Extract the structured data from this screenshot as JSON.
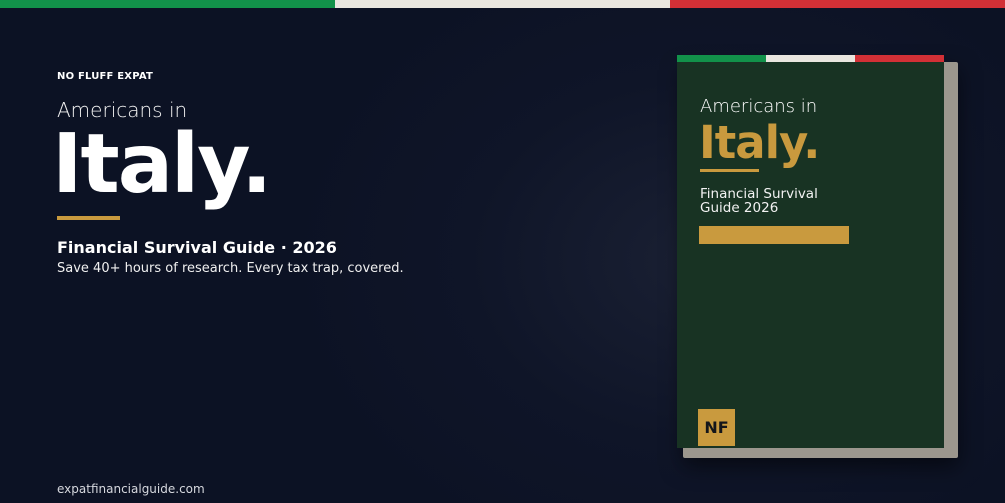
{
  "colors": {
    "flag_green": "#12924a",
    "flag_white": "#e9e6df",
    "flag_red": "#d23036",
    "gold": "#c99a3e",
    "book_green": "#183323"
  },
  "hero": {
    "brand": "NO FLUFF EXPAT",
    "pre_title": "Americans in",
    "title": "Italy.",
    "subtitle": "Financial Survival Guide · 2026",
    "tagline": "Save 40+ hours of research. Every tax trap, covered.",
    "website": "expatfinancialguide.com"
  },
  "book": {
    "pre_title": "Americans in",
    "title": "Italy.",
    "subtitle": "Financial Survival Guide 2026",
    "logo": "NF"
  }
}
